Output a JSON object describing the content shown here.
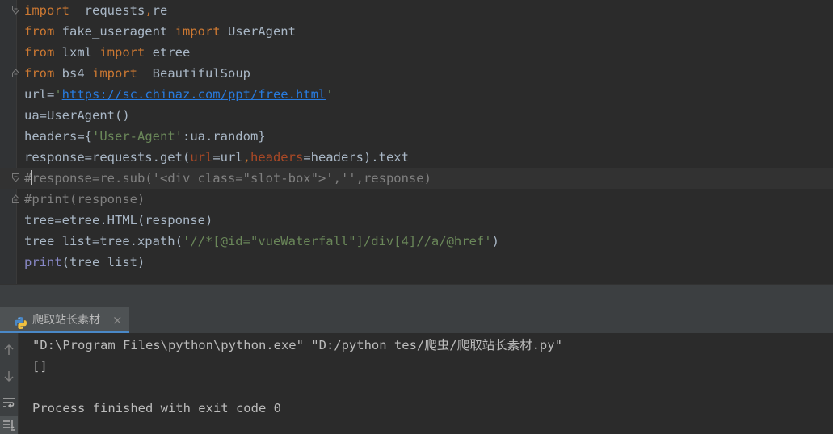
{
  "editor": {
    "lines": [
      {
        "parts": [
          {
            "t": "import",
            "c": "kw"
          },
          {
            "t": "  requests",
            "c": ""
          },
          {
            "t": ",",
            "c": "kw"
          },
          {
            "t": "re",
            "c": ""
          }
        ]
      },
      {
        "parts": [
          {
            "t": "from",
            "c": "kw"
          },
          {
            "t": " fake_useragent ",
            "c": ""
          },
          {
            "t": "import",
            "c": "kw"
          },
          {
            "t": " UserAgent",
            "c": ""
          }
        ]
      },
      {
        "parts": [
          {
            "t": "from",
            "c": "kw"
          },
          {
            "t": " lxml ",
            "c": ""
          },
          {
            "t": "import",
            "c": "kw"
          },
          {
            "t": " etree",
            "c": ""
          }
        ]
      },
      {
        "parts": [
          {
            "t": "from",
            "c": "kw"
          },
          {
            "t": " bs4 ",
            "c": ""
          },
          {
            "t": "import",
            "c": "kw"
          },
          {
            "t": "  BeautifulSoup",
            "c": ""
          }
        ]
      },
      {
        "parts": [
          {
            "t": "url=",
            "c": ""
          },
          {
            "t": "'",
            "c": "str"
          },
          {
            "t": "https://sc.chinaz.com/ppt/free.html",
            "c": "url"
          },
          {
            "t": "'",
            "c": "str"
          }
        ]
      },
      {
        "parts": [
          {
            "t": "ua=UserAgent()",
            "c": ""
          }
        ]
      },
      {
        "parts": [
          {
            "t": "headers={",
            "c": ""
          },
          {
            "t": "'User-Agent'",
            "c": "str"
          },
          {
            "t": ":ua.random}",
            "c": ""
          }
        ]
      },
      {
        "parts": [
          {
            "t": "response=requests.get(",
            "c": ""
          },
          {
            "t": "url",
            "c": "param"
          },
          {
            "t": "=url",
            "c": ""
          },
          {
            "t": ",",
            "c": "kw"
          },
          {
            "t": "headers",
            "c": "param"
          },
          {
            "t": "=headers).text",
            "c": ""
          }
        ]
      },
      {
        "parts": [
          {
            "t": "#",
            "c": "cmt"
          },
          {
            "t": "",
            "c": "caret"
          },
          {
            "t": "response=re.sub('<div class=\"slot-box\">','',response)",
            "c": "cmt"
          }
        ]
      },
      {
        "parts": [
          {
            "t": "#print(response)",
            "c": "cmt"
          }
        ]
      },
      {
        "parts": [
          {
            "t": "tree=etree.HTML(response)",
            "c": ""
          }
        ]
      },
      {
        "parts": [
          {
            "t": "tree_list=tree.xpath(",
            "c": ""
          },
          {
            "t": "'//*[@id=\"vueWaterfall\"]/div[4]//a/@href'",
            "c": "str"
          },
          {
            "t": ")",
            "c": ""
          }
        ]
      },
      {
        "parts": [
          {
            "t": "print",
            "c": "builtin"
          },
          {
            "t": "(tree_list)",
            "c": ""
          }
        ]
      }
    ]
  },
  "run_panel": {
    "tab_label": "爬取站长素材",
    "close_glyph": "×",
    "console": [
      "\"D:\\Program Files\\python\\python.exe\" \"D:/python tes/爬虫/爬取站长素材.py\"",
      "[]",
      "",
      "Process finished with exit code 0"
    ]
  },
  "icons": [
    "fold-icon",
    "python-icon",
    "close-icon",
    "arrow-up-icon",
    "arrow-down-icon",
    "soft-wrap-icon",
    "scroll-to-end-icon"
  ]
}
